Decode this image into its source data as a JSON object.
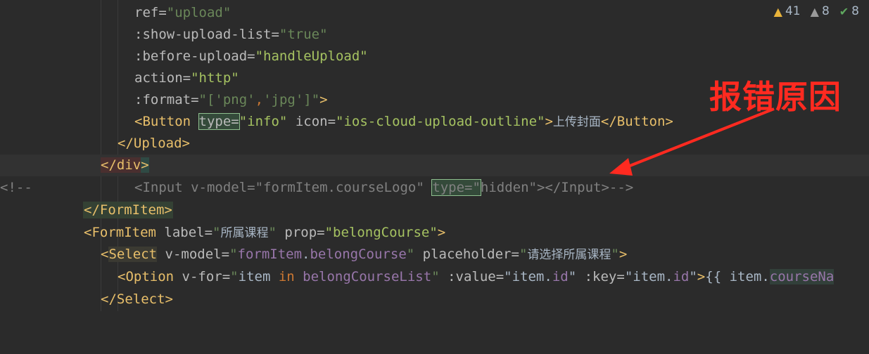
{
  "indicators": {
    "warnings": "41",
    "weak_warnings": "8",
    "ok": "8"
  },
  "annotation": {
    "text": "报错原因"
  },
  "code": {
    "l1": {
      "attr": "ref=",
      "val": "\"upload\""
    },
    "l2": {
      "attr": ":show-upload-list=",
      "val": "\"true\""
    },
    "l3": {
      "attr": ":before-upload=",
      "val": "\"handleUpload\""
    },
    "l4": {
      "attr": "action=",
      "val": "\"http\""
    },
    "l5": {
      "attr": ":format=",
      "val_open": "\"[",
      "s1": "'png'",
      "comma": ",",
      "s2": "'jpg'",
      "val_close": "]\"",
      "close": ">"
    },
    "l6": {
      "open": "<Button",
      "a1": "type=",
      "v1": "\"info\"",
      "a2": "icon=",
      "v2": "\"ios-cloud-upload-outline\"",
      "gt": ">",
      "text": "上传封面",
      "close": "</Button>"
    },
    "l7": {
      "close": "</Upload>"
    },
    "l8": {
      "open": "</",
      "name": "div",
      "gt": ">"
    },
    "l9": {
      "c_open": "<!--",
      "part1": "<Input v-model=\"formItem.courseLogo\" ",
      "type": "type=\"",
      "part2": "hidden\"></Input>-->"
    },
    "l10": {
      "close": "</FormItem>"
    },
    "l11": {
      "open": "<FormItem",
      "a1": "label=",
      "v1_open": "\"",
      "v1_text": "所属课程",
      "v1_close": "\"",
      "a2": "prop=",
      "v2": "\"belongCourse\"",
      "gt": ">"
    },
    "l12": {
      "lt": "<",
      "name": "Select",
      "a1": "v-model=",
      "v1_q": "\"",
      "v1_obj": "formItem",
      "v1_dot": ".",
      "v1_prop": "belongCourse",
      "v1_q2": "\"",
      "a2": "placeholder=",
      "v2_q": "\"",
      "v2_text": "请选择所属课程",
      "v2_q2": "\"",
      "gt": ">"
    },
    "l13": {
      "open": "<Option",
      "a1": "v-for=",
      "q1": "\"",
      "item": "item ",
      "in": "in",
      "list": " belongCourseList",
      "q2": "\"",
      "a2": ":value=",
      "v2": "\"item.",
      "v2b": "id",
      "v2c": "\"",
      "a3": ":key=",
      "v3": "\"item.",
      "v3b": "id",
      "v3c": "\"",
      "gt": ">",
      "interp": "{{ item.",
      "interp2": "courseNa"
    },
    "l14": {
      "close": "</Select>"
    }
  }
}
